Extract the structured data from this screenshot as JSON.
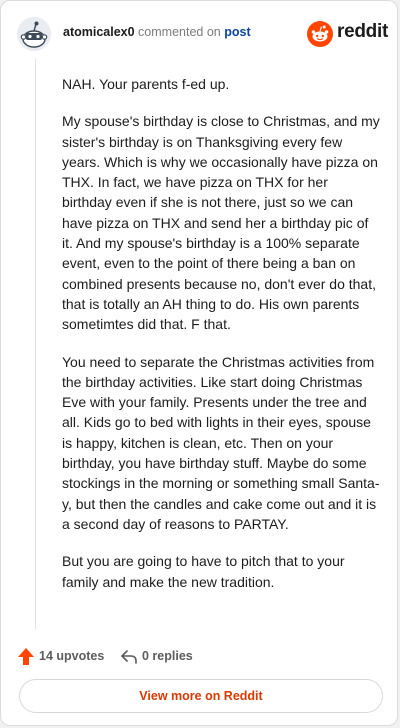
{
  "header": {
    "username": "atomicalex0",
    "action": " commented on ",
    "post_link": "post",
    "brand": "reddit"
  },
  "comment": {
    "paragraphs": [
      "NAH. Your parents f-ed up.",
      "My spouse's birthday is close to Christmas, and my sister's birthday is on Thanksgiving every few years. Which is why we occasionally have pizza on THX. In fact, we have pizza on THX for her birthday even if she is not there, just so we can have pizza on THX and send her a birthday pic of it. And my spouse's birthday is a 100% separate event, even to the point of there being a ban on combined presents because no, don't ever do that, that is totally an AH thing to do. His own parents sometimtes did that. F that.",
      "You need to separate the Christmas activities from the birthday activities. Like start doing Christmas Eve with your family. Presents under the tree and all. Kids go to bed with lights in their eyes, spouse is happy, kitchen is clean, etc. Then on your birthday, you have birthday stuff. Maybe do some stockings in the morning or something small Santa-y, but then the candles and cake come out and it is a second day of reasons to PARTAY.",
      "But you are going to have to pitch that to your family and make the new tradition."
    ]
  },
  "footer": {
    "upvotes": "14 upvotes",
    "replies": "0 replies",
    "view_more": "View more on Reddit"
  },
  "colors": {
    "brand_orange": "#ff4500",
    "link_blue": "#0a449b",
    "cta_orange": "#d93a00"
  },
  "icons": {
    "avatar": "snoo-avatar-icon",
    "brand": "reddit-logo-icon",
    "upvote": "upvote-arrow-icon",
    "reply": "reply-arrow-icon"
  }
}
